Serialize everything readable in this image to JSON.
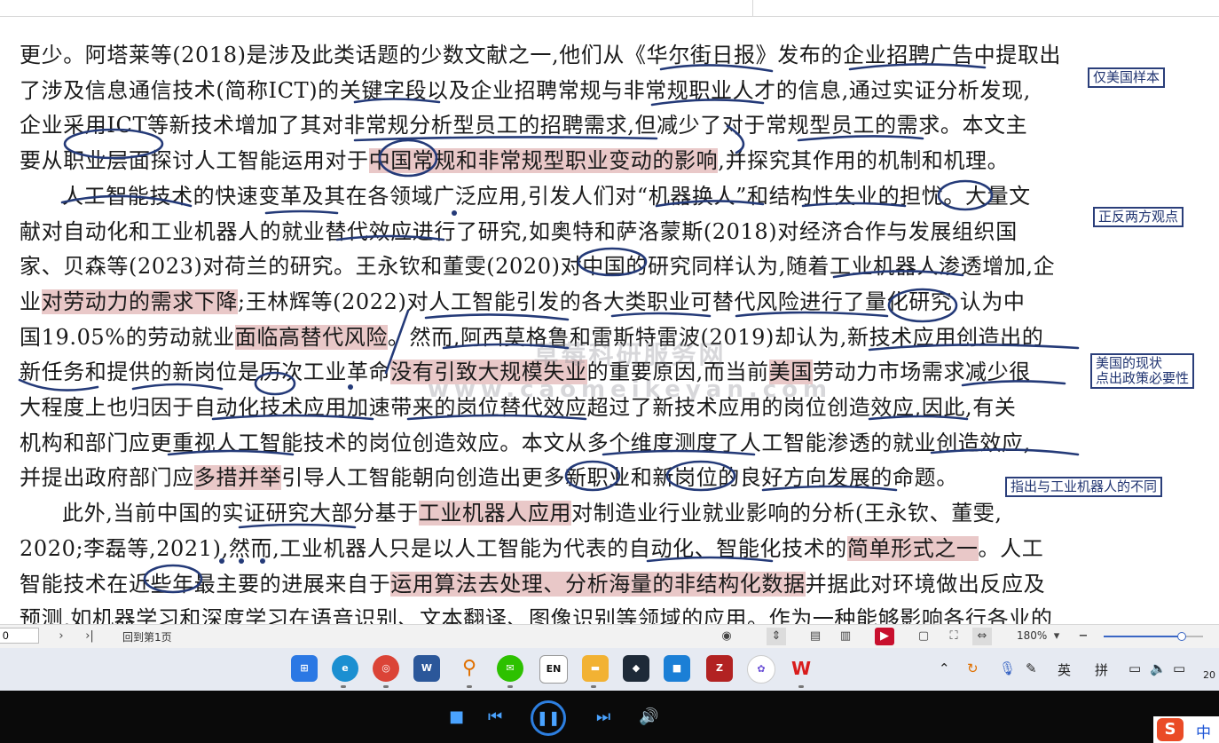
{
  "document": {
    "lines": [
      {
        "parts": [
          {
            "t": "更少。阿塔莱等(2018)是涉及此类话题的少数文献之一,他们从《华尔街日报》发布的企业招聘广告中提取出"
          }
        ]
      },
      {
        "parts": [
          {
            "t": "了涉及信息通信技术(简称ICT)的关键字段以及企业招聘常规与非常规职业人才的信息,通过实证分析发现,"
          }
        ]
      },
      {
        "parts": [
          {
            "t": "企业采用ICT等新技术增加了其对非常规分析型员工的招聘需求,但减少了对于常规型员工的需求。本文主"
          }
        ]
      },
      {
        "parts": [
          {
            "t": "要从职业层面探讨人工智能运用对于"
          },
          {
            "t": "中国常规和非常规型职业变动的影响",
            "h": true
          },
          {
            "t": ",并探究其作用的机制和机理。"
          }
        ]
      },
      {
        "indent": true,
        "parts": [
          {
            "t": "人工智能技术的快速变革及其在各领域广泛应用,引发人们对“机器换人”和结构性失业的担忧。大量文"
          }
        ]
      },
      {
        "parts": [
          {
            "t": "献对自动化和工业机器人的就业替代效应进行了研究,如奥特和萨洛蒙斯(2018)对经济合作与发展组织国"
          }
        ]
      },
      {
        "parts": [
          {
            "t": "家、贝森等(2023)对荷兰的研究。王永钦和董雯(2020)对中国的研究同样认为,随着工业机器人渗透增加,企"
          }
        ]
      },
      {
        "parts": [
          {
            "t": "业"
          },
          {
            "t": "对劳动力的需求下降",
            "h": true
          },
          {
            "t": ";王林辉等(2022)对人工智能引发的各大类职业可替代风险进行了量化研究,认为中"
          }
        ]
      },
      {
        "parts": [
          {
            "t": "国19.05%的劳动就业"
          },
          {
            "t": "面临高替代风险",
            "h": true
          },
          {
            "t": "。然而,阿西莫格鲁和雷斯特雷波(2019)却认为,新技术应用创造出的"
          }
        ]
      },
      {
        "parts": [
          {
            "t": "新任务和提供的新岗位是历次工业革命"
          },
          {
            "t": "没有引致大规模失业",
            "h": true
          },
          {
            "t": "的重要原因,而当前"
          },
          {
            "t": "美国",
            "h": true
          },
          {
            "t": "劳动力市场需求减少很"
          }
        ]
      },
      {
        "parts": [
          {
            "t": "大程度上也归因于自动化技术应用加速带来的岗位替代效应超过了新技术应用的岗位创造效应,因此,有关"
          }
        ]
      },
      {
        "parts": [
          {
            "t": "机构和部门应更重视人工智能技术的岗位创造效应。本文从多个维度测度了人工智能渗透的就业创造效应,"
          }
        ]
      },
      {
        "parts": [
          {
            "t": "并提出政府部门应"
          },
          {
            "t": "多措并举",
            "h": true
          },
          {
            "t": "引导人工智能朝向创造出更多新职业和新岗位的良好方向发展的命题。"
          }
        ]
      },
      {
        "indent": true,
        "parts": [
          {
            "t": "此外,当前中国的实证研究大部分基于"
          },
          {
            "t": "工业机器人应用",
            "h": true
          },
          {
            "t": "对制造业行业就业影响的分析(王永钦、董雯,"
          }
        ]
      },
      {
        "parts": [
          {
            "t": "2020;李磊等,2021),然而,工业机器人只是以人工智能为代表的自动化、智能化技术的"
          },
          {
            "t": "简单形式之一",
            "h": true
          },
          {
            "t": "。人工"
          }
        ]
      },
      {
        "parts": [
          {
            "t": "智能技术在近些年最主要的进展来自于"
          },
          {
            "t": "运用算法去处理、分析海量的非结构化数据",
            "h": true
          },
          {
            "t": "并据此对环境做出反应及"
          }
        ]
      },
      {
        "parts": [
          {
            "t": "预测,如机器学习和深度学习在语音识别、文本翻译、图像识别等领域的应用。作为一种能够影响各行各业的"
          }
        ]
      }
    ],
    "notes": {
      "n1": "仅美国样本",
      "n2": "正反两方观点",
      "n3a": "美国的现状",
      "n3b": "点出政策必要性",
      "n4": "指出与工业机器人的不同"
    },
    "watermark": {
      "line1": "草莓科研服务网",
      "line2": "www.caomeikeyan.com"
    }
  },
  "statusbar": {
    "page_value": "0",
    "next_label": "›",
    "last_label": "›|",
    "back_to_first": "回到第1页",
    "zoom_label": "180%",
    "zoom_level": 0.78
  },
  "taskbar": {
    "apps": [
      "windows-start",
      "edge",
      "chrome",
      "word",
      "search-tool",
      "wechat",
      "en-dictionary",
      "file-explorer",
      "app-cube",
      "app-blue",
      "app-red",
      "app-flower",
      "wps"
    ],
    "tray": {
      "lang": "英",
      "ime": "拼",
      "clock": "20"
    }
  },
  "player": {
    "ime_logo": "S",
    "ime_lang": "中"
  }
}
